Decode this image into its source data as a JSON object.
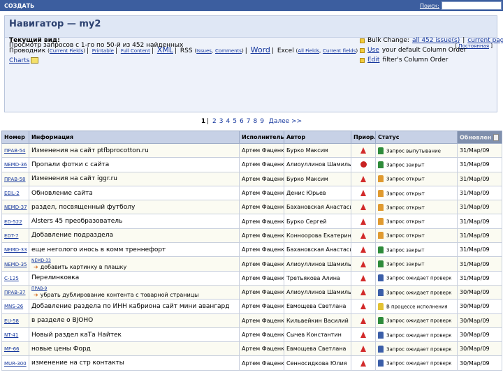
{
  "topbar": {
    "create_label": "СОЗДАТЬ",
    "search_label": "Поиск:",
    "search_value": ""
  },
  "navigator": {
    "title": "Навигатор — my2",
    "subtitle": "Просмотр запросов с 1-го по 50-й из 452 найденных",
    "permalink": "Постоянная"
  },
  "views": {
    "heading": "Текущий вид:",
    "line1": {
      "prefix": "Проводник",
      "current_fields": "Current Fields",
      "printable": "Printable",
      "full_content": "Full Content",
      "xml": "XML",
      "rss": "RSS",
      "issues": "Issues",
      "comments": "Comments",
      "word": "Word",
      "excel": "Excel",
      "all_fields": "All Fields",
      "current_fields2": "Current fields"
    },
    "charts": "Charts"
  },
  "actions": {
    "bulk_prefix": "Bulk Change:",
    "bulk_all": "all 452 issue(s)",
    "bulk_current": "current page",
    "use_label": "Use",
    "use_rest": "your default Column Order",
    "edit_label": "Edit",
    "edit_rest": "filter's Column Order"
  },
  "pager": {
    "current": "1",
    "pages": [
      "2",
      "3",
      "4",
      "5",
      "6",
      "7",
      "8",
      "9"
    ],
    "next": "Далее >>"
  },
  "table": {
    "headers": [
      "Номер",
      "Информация",
      "Исполнитель",
      "Автор",
      "Приор.",
      "Статус",
      "Обновлен"
    ],
    "rows": [
      {
        "key": "ПРАВ-54",
        "parent": "",
        "info": "Изменения на сайт ptfbprocotton.ru",
        "assignee": "Артем Фаценко",
        "author": "Бурко Максим",
        "prio": "up",
        "status": "Запрос выпутывание",
        "st": "green",
        "updated": "31/Мар/09"
      },
      {
        "key": "NEMD-36",
        "parent": "",
        "info": "Пропали фотки с сайта",
        "assignee": "Артем Фаценко",
        "author": "Алиоуллинов Шамиль",
        "prio": "block",
        "status": "Запрос закрыт",
        "st": "green",
        "updated": "31/Мар/09"
      },
      {
        "key": "ПРАВ-58",
        "parent": "",
        "info": "Изменения на сайт iggr.ru",
        "assignee": "Артем Фаценко",
        "author": "Бурко Максим",
        "prio": "up",
        "status": "Запрос открыт",
        "st": "orange",
        "updated": "31/Мар/09"
      },
      {
        "key": "EEIL-2",
        "parent": "",
        "info": "Обновление сайта",
        "assignee": "Артем Фаценко",
        "author": "Денис Юрьев",
        "prio": "up",
        "status": "Запрос открыт",
        "st": "orange",
        "updated": "31/Мар/09"
      },
      {
        "key": "NEMD-37",
        "parent": "",
        "info": "раздел, посвященный футболу",
        "assignee": "Артем Фаценко",
        "author": "Бахановская Анастасия",
        "prio": "up",
        "status": "Запрос открыт",
        "st": "orange",
        "updated": "31/Мар/09"
      },
      {
        "key": "ED-522",
        "parent": "",
        "info": "Alsters 45 преобразователь",
        "assignee": "Артем Фаценко",
        "author": "Бурко Сергей",
        "prio": "up",
        "status": "Запрос открыт",
        "st": "orange",
        "updated": "31/Мар/09"
      },
      {
        "key": "EDT-7",
        "parent": "",
        "info": "Добавление подраздела",
        "assignee": "Артем Фаценко",
        "author": "Конноорова Екатерина",
        "prio": "up",
        "status": "Запрос открыт",
        "st": "orange",
        "updated": "31/Мар/09"
      },
      {
        "key": "NEMD-33",
        "parent": "",
        "info": "еще неголого инось в комм треннефорт",
        "assignee": "Артем Фаценко",
        "author": "Бахановская Анастасия",
        "prio": "up",
        "status": "Запрос закрыт",
        "st": "green",
        "updated": "31/Мар/09"
      },
      {
        "key": "NEMD-35",
        "parent": "NEMD-33",
        "info": "добавить картинку в плашку",
        "assignee": "Артем Фаценко",
        "author": "Алиоуллинов Шамиль",
        "prio": "up",
        "status": "Запрос закрыт",
        "st": "green",
        "updated": "31/Мар/09"
      },
      {
        "key": "С-125",
        "parent": "",
        "info": "Перелинковка",
        "assignee": "Артем Фаценко",
        "author": "Третьякова Алина",
        "prio": "up",
        "status": "Запрос ожидает проверк",
        "st": "blue",
        "updated": "31/Мар/09"
      },
      {
        "key": "ПРАВ-37",
        "parent": "ПРАВ-9",
        "info": "убрать дублирование контента с товарной страницы",
        "assignee": "Артем Фаценко",
        "author": "Алиоуллинов Шамиль",
        "prio": "up",
        "status": "Запрос ожидает проверк",
        "st": "blue",
        "updated": "30/Мар/09"
      },
      {
        "key": "MNS-26",
        "parent": "",
        "info": "Добавление раздела по ИНН кабриона сайт мини авангард",
        "assignee": "Артем Фаценко",
        "author": "Евмощева Светлана",
        "prio": "up",
        "status": "В процессе исполнения",
        "st": "yellow",
        "updated": "30/Мар/09"
      },
      {
        "key": "EU-58",
        "parent": "",
        "info": "в разделе o BJOHO",
        "assignee": "Артем Фаценко",
        "author": "Кильвейкин Василий",
        "prio": "up",
        "status": "Запрос ожидает проверк",
        "st": "green",
        "updated": "30/Мар/09"
      },
      {
        "key": "NT-41",
        "parent": "",
        "info": "Новый раздел каТа Найтек",
        "assignee": "Артем Фаценко",
        "author": "Сычев Константин",
        "prio": "up",
        "status": "Запрос ожидает проверк",
        "st": "blue",
        "updated": "30/Мар/09"
      },
      {
        "key": "MF-66",
        "parent": "",
        "info": "новые цены Форд",
        "assignee": "Артем Фаценко",
        "author": "Евмощева Светлана",
        "prio": "up",
        "status": "Запрос ожидает проверк",
        "st": "blue",
        "updated": "30/Мар/09"
      },
      {
        "key": "MUR-300",
        "parent": "",
        "info": "изменение на стр контакты",
        "assignee": "Артем Фаценко",
        "author": "Сенносидкова Юлия",
        "prio": "up",
        "status": "Запрос ожидает проверк",
        "st": "blue",
        "updated": "30/Мар/09"
      }
    ]
  }
}
